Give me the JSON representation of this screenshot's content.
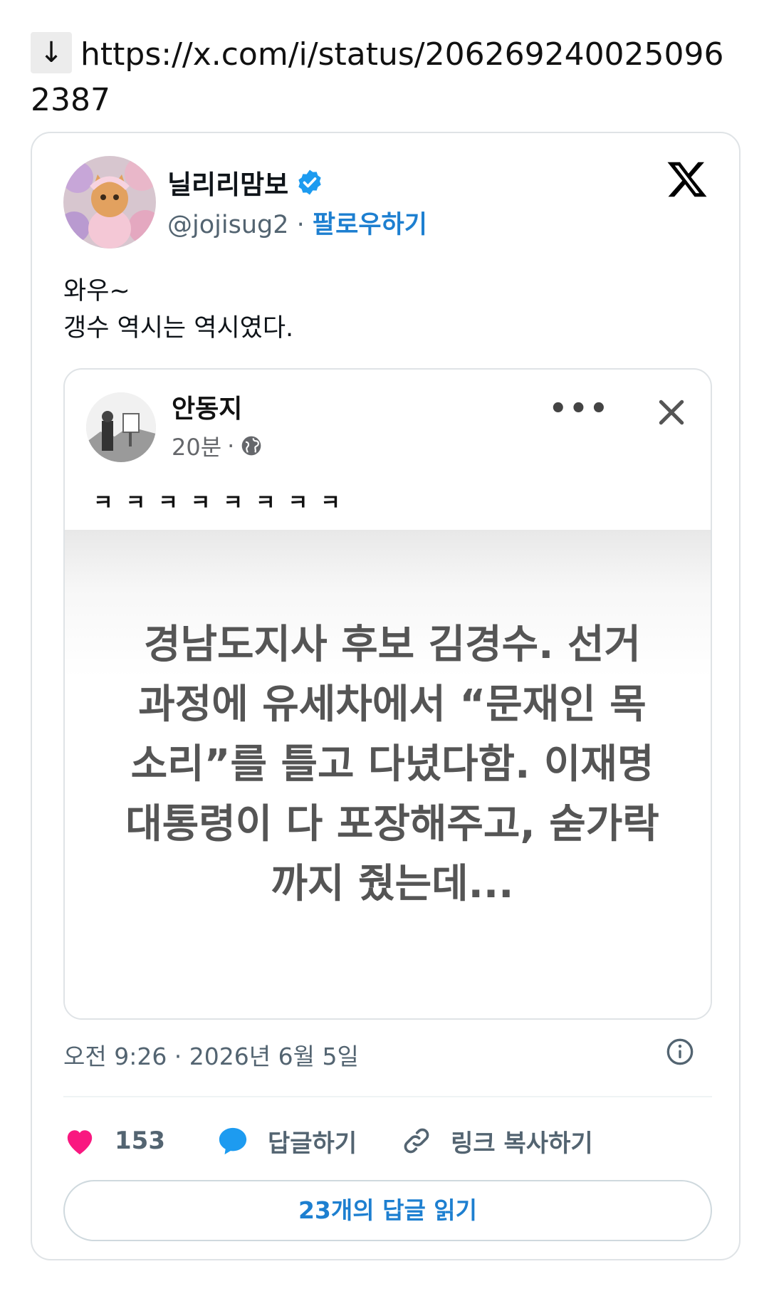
{
  "link": {
    "arrow": "↓",
    "url": "https://x.com/i/status/2062692400250962387"
  },
  "tweet": {
    "author_name": "닐리리맘보",
    "handle": "@jojisug2",
    "separator": "·",
    "follow_label": "팔로우하기",
    "text_line1": "와우~",
    "text_line2": "갱수 역시는 역시였다.",
    "timestamp": "오전 9:26 · 2026년 6월 5일",
    "likes": "153",
    "reply_label": "답글하기",
    "copy_link_label": "링크 복사하기",
    "read_replies_label": "23개의 답글 읽기"
  },
  "embedded_post": {
    "author_name": "안동지",
    "time": "20분",
    "separator": "·",
    "text": "ㅋㅋㅋㅋㅋㅋㅋㅋ",
    "headline_line1": "경남도지사 후보 김경수. 선거",
    "headline_line2": "과정에 유세차에서 “문재인 목",
    "headline_line3": "소리”를 틀고 다녔다함. 이재명",
    "headline_line4": "대통령이 다 포장해주고, 숟가락",
    "headline_line5": "까지 줬는데..."
  },
  "colors": {
    "accent": "#1d7fd0",
    "like": "#f91880",
    "reply_icon": "#1d9bf0",
    "muted": "#536471"
  },
  "icons": [
    "verified-badge-icon",
    "x-logo-icon",
    "more-dots-icon",
    "close-icon",
    "globe-icon",
    "info-icon",
    "heart-icon",
    "reply-bubble-icon",
    "link-icon"
  ]
}
